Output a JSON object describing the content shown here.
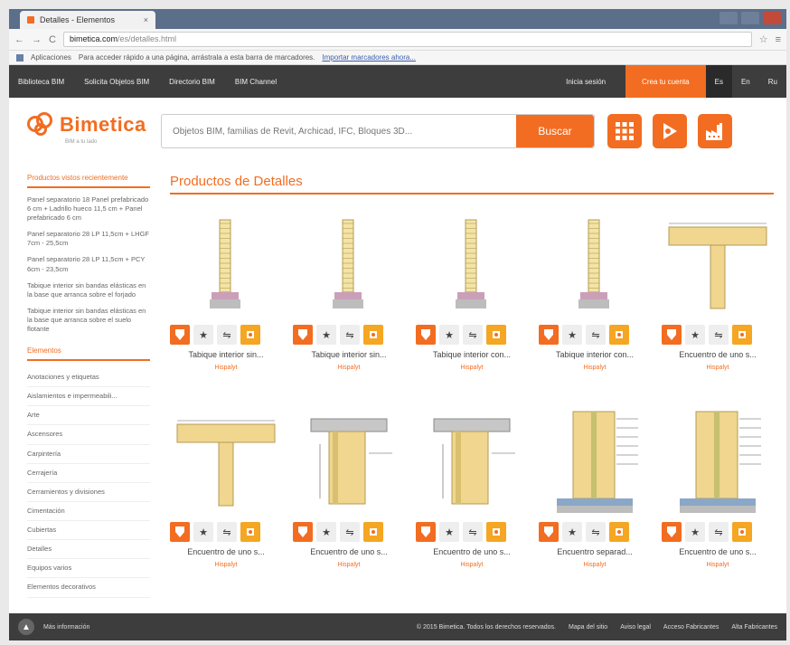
{
  "browser": {
    "tab_title": "Detalles - Elementos",
    "tab_close": "×",
    "back": "←",
    "forward": "→",
    "reload": "C",
    "url_host": "bimetica.com",
    "url_path": "/es/detalles.html",
    "apps_label": "Aplicaciones",
    "bookmarks_hint": "Para acceder rápido a una página, arrástrala a esta barra de marcadores.",
    "bookmarks_link": "Importar marcadores ahora..."
  },
  "topnav": {
    "items": [
      "Biblioteca BIM",
      "Solicita Objetos BIM",
      "Directorio BIM",
      "BIM Channel"
    ],
    "login": "Inicia sesión",
    "signup": "Crea tu cuenta",
    "langs": [
      "Es",
      "En",
      "Ru"
    ]
  },
  "header": {
    "logo_text": "Bimetica",
    "logo_sub": "BIM a tu lado",
    "search_placeholder": "Objetos BIM, familias de Revit, Archicad, IFC, Bloques 3D...",
    "search_button": "Buscar"
  },
  "sidebar": {
    "recent_title": "Productos vistos recientemente",
    "recent_items": [
      "Panel separatorio 18 Panel prefabricado 6 cm + Ladrillo hueco 11,5 cm + Panel prefabricado 6 cm",
      "Panel separatorio 28 LP 11,5cm + LHGF 7cm - 25,5cm",
      "Panel separatorio 28 LP 11,5cm + PCY 6cm - 23,5cm",
      "Tabique interior sin bandas elásticas en la base que arranca sobre el forjado",
      "Tabique interior sin bandas elásticas en la base que arranca sobre el suelo flotante"
    ],
    "cat_title": "Elementos",
    "categories": [
      "Anotaciones y etiquetas",
      "Aislamientos e impermeabili...",
      "Arte",
      "Ascensores",
      "Carpintería",
      "Cerrajería",
      "Cerramientos y divisiones",
      "Cimentación",
      "Cubiertas",
      "Detalles",
      "Equipos varios",
      "Elementos decorativos"
    ]
  },
  "main": {
    "title": "Productos de Detalles",
    "products": [
      {
        "name": "Tabique interior sin...",
        "brand": "Hispalyt"
      },
      {
        "name": "Tabique interior sin...",
        "brand": "Hispalyt"
      },
      {
        "name": "Tabique interior con...",
        "brand": "Hispalyt"
      },
      {
        "name": "Tabique interior con...",
        "brand": "Hispalyt"
      },
      {
        "name": "Encuentro de uno s...",
        "brand": "Hispalyt"
      },
      {
        "name": "Encuentro de uno s...",
        "brand": "Hispalyt"
      },
      {
        "name": "Encuentro de uno s...",
        "brand": "Hispalyt"
      },
      {
        "name": "Encuentro de uno s...",
        "brand": "Hispalyt"
      },
      {
        "name": "Encuentro separad...",
        "brand": "Hispalyt"
      },
      {
        "name": "Encuentro de uno s...",
        "brand": "Hispalyt"
      }
    ]
  },
  "footer": {
    "more": "Más información",
    "copyright": "© 2015 Bimetica. Todos los derechos reservados.",
    "links": [
      "Mapa del sitio",
      "Aviso legal",
      "Acceso Fabricantes",
      "Alta Fabricantes"
    ]
  },
  "colors": {
    "accent": "#f26d21",
    "nav": "#3d3d3d"
  },
  "icons": {
    "download": "download-icon",
    "favorite": "star-icon",
    "compare": "compare-icon",
    "bim": "bim-object-icon"
  }
}
